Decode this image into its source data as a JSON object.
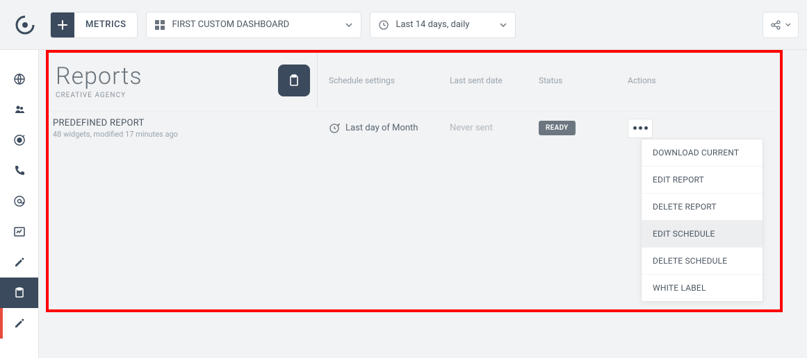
{
  "topbar": {
    "metrics_label": "METRICS",
    "dashboard_label": "FIRST CUSTOM DASHBOARD",
    "date_label": "Last 14 days, daily"
  },
  "page": {
    "title": "Reports",
    "subtitle": "CREATIVE AGENCY"
  },
  "columns": {
    "schedule": "Schedule settings",
    "last_sent": "Last sent date",
    "status": "Status",
    "actions": "Actions"
  },
  "reports": [
    {
      "name": "PREDEFINED REPORT",
      "meta": "48 widgets, modified 17 minutes ago",
      "schedule": "Last day of Month",
      "last_sent": "Never sent",
      "status": "READY"
    }
  ],
  "action_menu": {
    "items": [
      "DOWNLOAD CURRENT",
      "EDIT REPORT",
      "DELETE REPORT",
      "EDIT SCHEDULE",
      "DELETE SCHEDULE",
      "WHITE LABEL"
    ],
    "highlighted_index": 3
  },
  "colors": {
    "accent": "#e74c3c",
    "dark": "#3b4a5c",
    "frame": "#f00"
  }
}
